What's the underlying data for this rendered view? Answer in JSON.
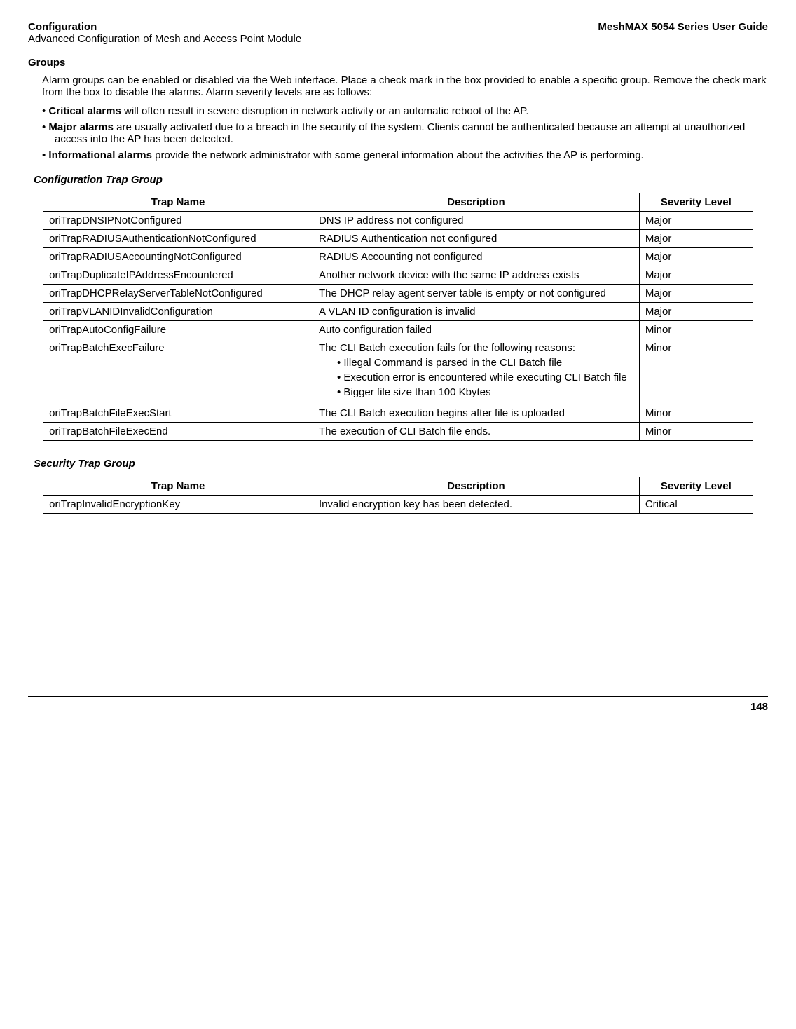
{
  "header": {
    "section": "Configuration",
    "subtitle": "Advanced Configuration of Mesh and Access Point Module",
    "guide": "MeshMAX 5054 Series User Guide"
  },
  "groups_heading": "Groups",
  "intro": "Alarm groups can be enabled or disabled via the Web interface. Place a check mark in the box provided to enable a specific group. Remove the check mark from the box to disable the alarms. Alarm severity levels are as follows:",
  "severity_items": [
    {
      "bold": "Critical alarms",
      "rest": " will often result in severe disruption in network activity or an automatic reboot of the AP."
    },
    {
      "bold": "Major alarms",
      "rest": " are usually activated due to a breach in the security of the system. Clients cannot be authenticated because an attempt at unauthorized access into the AP has been detected."
    },
    {
      "bold": "Informational alarms",
      "rest": " provide the network administrator with some general information about the activities the AP is performing."
    }
  ],
  "config_trap_heading": "Configuration Trap Group",
  "table_headers": {
    "name": "Trap Name",
    "desc": "Description",
    "sev": "Severity Level"
  },
  "config_traps": [
    {
      "name": "oriTrapDNSIPNotConfigured",
      "desc": "DNS IP address not configured",
      "sev": "Major"
    },
    {
      "name": "oriTrapRADIUSAuthenticationNotConfigured",
      "desc": "RADIUS Authentication not configured",
      "sev": "Major"
    },
    {
      "name": "oriTrapRADIUSAccountingNotConfigured",
      "desc": "RADIUS Accounting not configured",
      "sev": "Major"
    },
    {
      "name": "oriTrapDuplicateIPAddressEncountered",
      "desc": "Another network device with the same IP address exists",
      "sev": "Major"
    },
    {
      "name": "oriTrapDHCPRelayServerTableNotConfigured",
      "desc": "The DHCP relay agent server table is empty or not configured",
      "sev": "Major"
    },
    {
      "name": "oriTrapVLANIDInvalidConfiguration",
      "desc": "A VLAN ID configuration is invalid",
      "sev": "Major"
    },
    {
      "name": "oriTrapAutoConfigFailure",
      "desc": "Auto configuration failed",
      "sev": "Minor"
    },
    {
      "name": "oriTrapBatchExecFailure",
      "desc_intro": "The CLI Batch execution fails for the following reasons:",
      "desc_list": [
        "Illegal Command is parsed in the CLI Batch file",
        "Execution error is encountered while executing CLI Batch file",
        "Bigger file size than 100 Kbytes"
      ],
      "sev": "Minor"
    },
    {
      "name": "oriTrapBatchFileExecStart",
      "desc": "The CLI Batch execution begins after file is uploaded",
      "sev": "Minor"
    },
    {
      "name": "oriTrapBatchFileExecEnd",
      "desc": "The execution of CLI Batch file ends.",
      "sev": "Minor"
    }
  ],
  "security_trap_heading": "Security Trap Group",
  "security_traps": [
    {
      "name": "oriTrapInvalidEncryptionKey",
      "desc": "Invalid encryption key has been detected.",
      "sev": "Critical"
    }
  ],
  "page_number": "148"
}
